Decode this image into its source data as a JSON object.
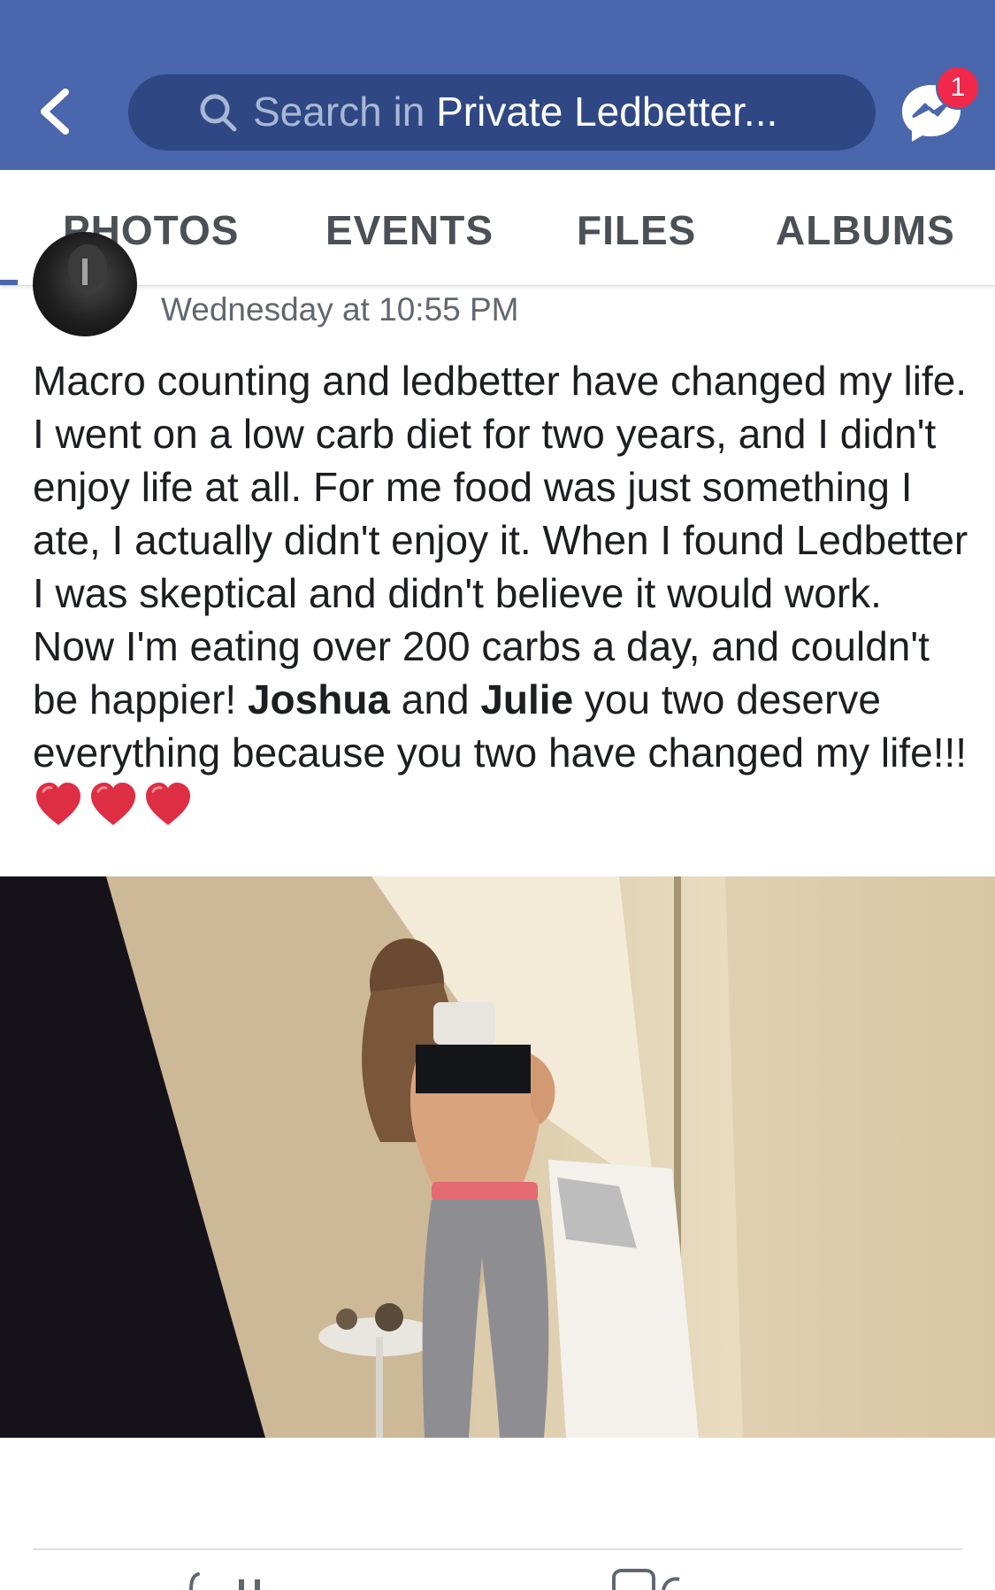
{
  "header": {
    "search_prefix": "Search in ",
    "search_scope": "Private Ledbetter...",
    "notification_count": "1",
    "background": "#4a66ad"
  },
  "tabs": [
    {
      "label": "PHOTOS"
    },
    {
      "label": "EVENTS"
    },
    {
      "label": "FILES"
    },
    {
      "label": "ALBUMS"
    }
  ],
  "post": {
    "timestamp": "Wednesday at 10:55 PM",
    "text_part1": "Macro counting and ledbetter have changed my life. I went on a low carb diet for two years, and I didn't enjoy life at all. For me food was just something I ate, I actually didn't enjoy it. When I found Ledbetter I was skeptical and didn't believe it would work. Now I'm eating over 200 carbs a day, and couldn't be happier!  ",
    "mention1": "Joshua",
    "text_part2": " and ",
    "mention2": "Julie",
    "text_part3": " you two deserve everything because you two have changed my life!!!",
    "emoji": [
      "heart-emoji",
      "heart-emoji",
      "heart-emoji"
    ]
  },
  "photo": {
    "description_icon": "mirror-selfie-photo"
  }
}
